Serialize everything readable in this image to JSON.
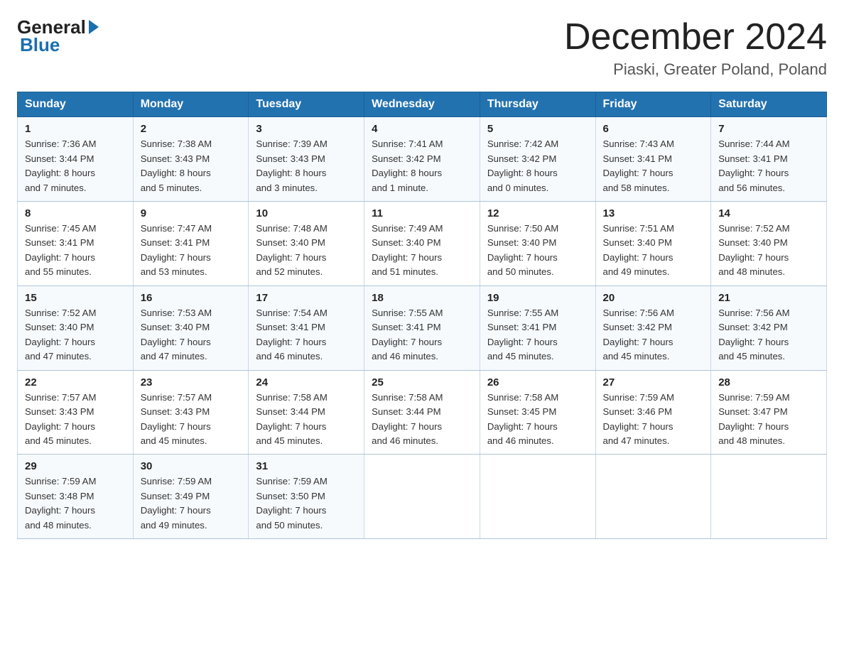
{
  "logo": {
    "general": "General",
    "blue": "Blue"
  },
  "title": "December 2024",
  "location": "Piaski, Greater Poland, Poland",
  "days_of_week": [
    "Sunday",
    "Monday",
    "Tuesday",
    "Wednesday",
    "Thursday",
    "Friday",
    "Saturday"
  ],
  "weeks": [
    [
      {
        "day": "1",
        "sunrise": "7:36 AM",
        "sunset": "3:44 PM",
        "daylight": "8 hours and 7 minutes."
      },
      {
        "day": "2",
        "sunrise": "7:38 AM",
        "sunset": "3:43 PM",
        "daylight": "8 hours and 5 minutes."
      },
      {
        "day": "3",
        "sunrise": "7:39 AM",
        "sunset": "3:43 PM",
        "daylight": "8 hours and 3 minutes."
      },
      {
        "day": "4",
        "sunrise": "7:41 AM",
        "sunset": "3:42 PM",
        "daylight": "8 hours and 1 minute."
      },
      {
        "day": "5",
        "sunrise": "7:42 AM",
        "sunset": "3:42 PM",
        "daylight": "8 hours and 0 minutes."
      },
      {
        "day": "6",
        "sunrise": "7:43 AM",
        "sunset": "3:41 PM",
        "daylight": "7 hours and 58 minutes."
      },
      {
        "day": "7",
        "sunrise": "7:44 AM",
        "sunset": "3:41 PM",
        "daylight": "7 hours and 56 minutes."
      }
    ],
    [
      {
        "day": "8",
        "sunrise": "7:45 AM",
        "sunset": "3:41 PM",
        "daylight": "7 hours and 55 minutes."
      },
      {
        "day": "9",
        "sunrise": "7:47 AM",
        "sunset": "3:41 PM",
        "daylight": "7 hours and 53 minutes."
      },
      {
        "day": "10",
        "sunrise": "7:48 AM",
        "sunset": "3:40 PM",
        "daylight": "7 hours and 52 minutes."
      },
      {
        "day": "11",
        "sunrise": "7:49 AM",
        "sunset": "3:40 PM",
        "daylight": "7 hours and 51 minutes."
      },
      {
        "day": "12",
        "sunrise": "7:50 AM",
        "sunset": "3:40 PM",
        "daylight": "7 hours and 50 minutes."
      },
      {
        "day": "13",
        "sunrise": "7:51 AM",
        "sunset": "3:40 PM",
        "daylight": "7 hours and 49 minutes."
      },
      {
        "day": "14",
        "sunrise": "7:52 AM",
        "sunset": "3:40 PM",
        "daylight": "7 hours and 48 minutes."
      }
    ],
    [
      {
        "day": "15",
        "sunrise": "7:52 AM",
        "sunset": "3:40 PM",
        "daylight": "7 hours and 47 minutes."
      },
      {
        "day": "16",
        "sunrise": "7:53 AM",
        "sunset": "3:40 PM",
        "daylight": "7 hours and 47 minutes."
      },
      {
        "day": "17",
        "sunrise": "7:54 AM",
        "sunset": "3:41 PM",
        "daylight": "7 hours and 46 minutes."
      },
      {
        "day": "18",
        "sunrise": "7:55 AM",
        "sunset": "3:41 PM",
        "daylight": "7 hours and 46 minutes."
      },
      {
        "day": "19",
        "sunrise": "7:55 AM",
        "sunset": "3:41 PM",
        "daylight": "7 hours and 45 minutes."
      },
      {
        "day": "20",
        "sunrise": "7:56 AM",
        "sunset": "3:42 PM",
        "daylight": "7 hours and 45 minutes."
      },
      {
        "day": "21",
        "sunrise": "7:56 AM",
        "sunset": "3:42 PM",
        "daylight": "7 hours and 45 minutes."
      }
    ],
    [
      {
        "day": "22",
        "sunrise": "7:57 AM",
        "sunset": "3:43 PM",
        "daylight": "7 hours and 45 minutes."
      },
      {
        "day": "23",
        "sunrise": "7:57 AM",
        "sunset": "3:43 PM",
        "daylight": "7 hours and 45 minutes."
      },
      {
        "day": "24",
        "sunrise": "7:58 AM",
        "sunset": "3:44 PM",
        "daylight": "7 hours and 45 minutes."
      },
      {
        "day": "25",
        "sunrise": "7:58 AM",
        "sunset": "3:44 PM",
        "daylight": "7 hours and 46 minutes."
      },
      {
        "day": "26",
        "sunrise": "7:58 AM",
        "sunset": "3:45 PM",
        "daylight": "7 hours and 46 minutes."
      },
      {
        "day": "27",
        "sunrise": "7:59 AM",
        "sunset": "3:46 PM",
        "daylight": "7 hours and 47 minutes."
      },
      {
        "day": "28",
        "sunrise": "7:59 AM",
        "sunset": "3:47 PM",
        "daylight": "7 hours and 48 minutes."
      }
    ],
    [
      {
        "day": "29",
        "sunrise": "7:59 AM",
        "sunset": "3:48 PM",
        "daylight": "7 hours and 48 minutes."
      },
      {
        "day": "30",
        "sunrise": "7:59 AM",
        "sunset": "3:49 PM",
        "daylight": "7 hours and 49 minutes."
      },
      {
        "day": "31",
        "sunrise": "7:59 AM",
        "sunset": "3:50 PM",
        "daylight": "7 hours and 50 minutes."
      },
      null,
      null,
      null,
      null
    ]
  ],
  "labels": {
    "sunrise": "Sunrise:",
    "sunset": "Sunset:",
    "daylight": "Daylight:"
  }
}
